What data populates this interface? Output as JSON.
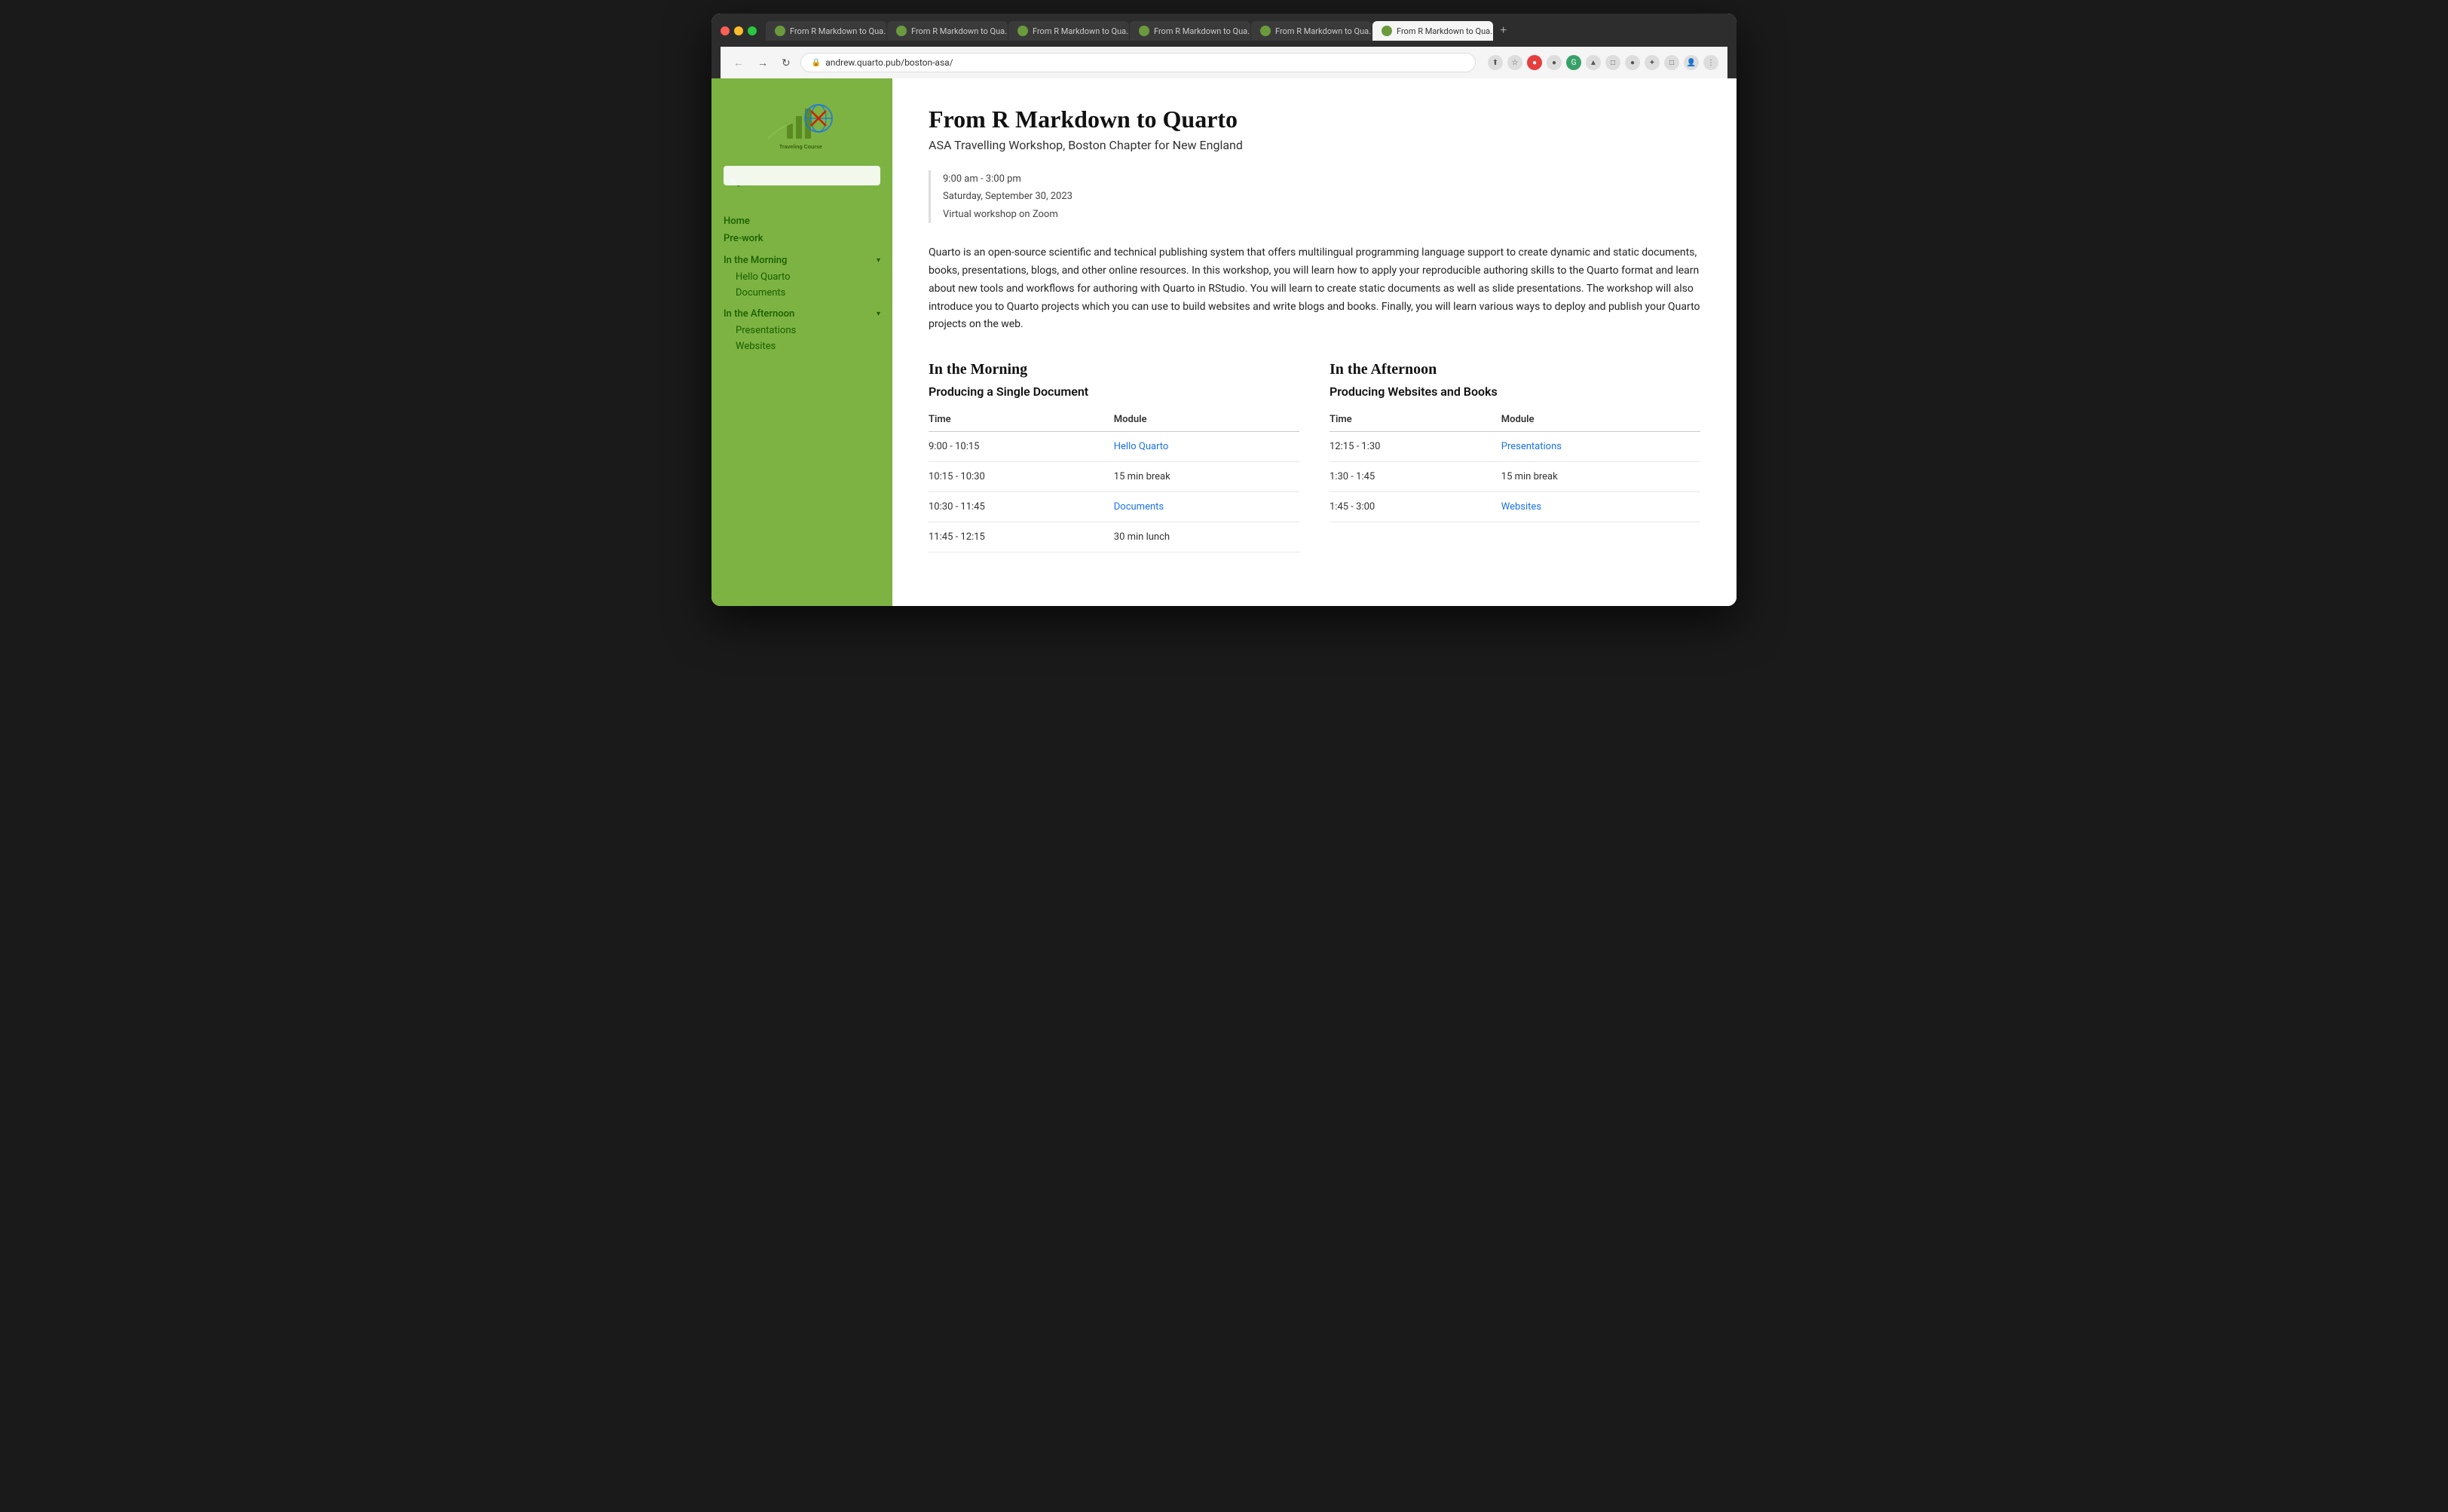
{
  "browser": {
    "tabs": [
      {
        "label": "From R Markdown to Qua...",
        "active": false
      },
      {
        "label": "From R Markdown to Qua...",
        "active": false
      },
      {
        "label": "From R Markdown to Qua...",
        "active": false
      },
      {
        "label": "From R Markdown to Qua...",
        "active": false
      },
      {
        "label": "From R Markdown to Qua...",
        "active": false
      },
      {
        "label": "From R Markdown to Qua...",
        "active": true
      }
    ],
    "address": "andrew.quarto.pub/boston-asa/"
  },
  "sidebar": {
    "logo_alt": "ASA Traveling Course Logo",
    "search_placeholder": "",
    "nav": [
      {
        "label": "Home",
        "href": "#",
        "type": "link"
      },
      {
        "label": "Pre-work",
        "href": "#",
        "type": "link"
      },
      {
        "label": "In the Morning",
        "type": "section",
        "children": [
          {
            "label": "Hello Quarto",
            "href": "#"
          },
          {
            "label": "Documents",
            "href": "#"
          }
        ]
      },
      {
        "label": "In the Afternoon",
        "type": "section",
        "children": [
          {
            "label": "Presentations",
            "href": "#"
          },
          {
            "label": "Websites",
            "href": "#"
          }
        ]
      }
    ]
  },
  "main": {
    "title": "From R Markdown to Quarto",
    "subtitle": "ASA Travelling Workshop, Boston Chapter for New England",
    "event_time": "9:00 am - 3:00 pm",
    "event_date": "Saturday, September 30, 2023",
    "event_location": "Virtual workshop on Zoom",
    "description": "Quarto is an open-source scientific and technical publishing system that offers multilingual programming language support to create dynamic and static documents, books, presentations, blogs, and other online resources. In this workshop, you will learn how to apply your reproducible authoring skills to the Quarto format and learn about new tools and workflows for authoring with Quarto in RStudio. You will learn to create static documents as well as slide presentations. The workshop will also introduce you to Quarto projects which you can use to build websites and write blogs and books. Finally, you will learn various ways to deploy and publish your Quarto projects on the web.",
    "morning": {
      "section_title": "In the Morning",
      "subsection_title": "Producing a Single Document",
      "columns": [
        "Time",
        "Module"
      ],
      "rows": [
        {
          "time": "9:00 - 10:15",
          "module": "Hello Quarto",
          "is_link": true
        },
        {
          "time": "10:15 - 10:30",
          "module": "15 min break",
          "is_link": false
        },
        {
          "time": "10:30 - 11:45",
          "module": "Documents",
          "is_link": true
        },
        {
          "time": "11:45 - 12:15",
          "module": "30 min lunch",
          "is_link": false
        }
      ]
    },
    "afternoon": {
      "section_title": "In the Afternoon",
      "subsection_title": "Producing Websites and Books",
      "columns": [
        "Time",
        "Module"
      ],
      "rows": [
        {
          "time": "12:15 - 1:30",
          "module": "Presentations",
          "is_link": true
        },
        {
          "time": "1:30 - 1:45",
          "module": "15 min break",
          "is_link": false
        },
        {
          "time": "1:45 - 3:00",
          "module": "Websites",
          "is_link": true
        }
      ]
    }
  }
}
